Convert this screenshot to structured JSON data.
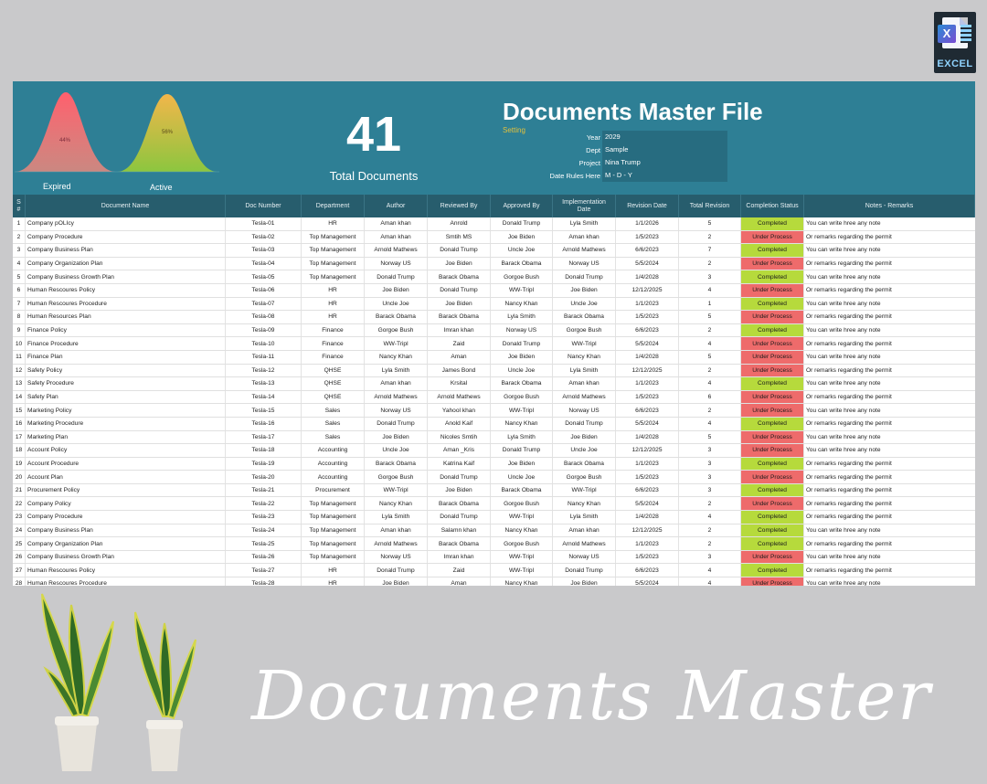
{
  "badge": {
    "label": "EXCEL",
    "letter": "X"
  },
  "header": {
    "title": "Documents Master File",
    "setting": "Setting",
    "total_count": "41",
    "total_label": "Total Documents",
    "gauges": [
      {
        "label": "Expired",
        "percent_text": "44%",
        "percent": 44
      },
      {
        "label": "Active",
        "percent_text": "56%",
        "percent": 56
      }
    ],
    "info": [
      {
        "key": "Year",
        "value": "2029"
      },
      {
        "key": "Dept",
        "value": "Sample"
      },
      {
        "key": "Project",
        "value": "Nina Trump"
      },
      {
        "key": "Date Rules Here",
        "value": "M - D - Y"
      }
    ]
  },
  "table": {
    "columns": [
      "S #",
      "Document Name",
      "Doc Number",
      "Department",
      "Author",
      "Reviewed By",
      "Approved By",
      "Implementation Date",
      "Revision Date",
      "Total Revision",
      "Completion Status",
      "Notes - Remarks"
    ],
    "rows": [
      [
        "1",
        "Company pOLIcy",
        "Tesla-01",
        "HR",
        "Aman khan",
        "Anrold",
        "Donald Trump",
        "Lyla Smith",
        "1/1/2026",
        "5",
        "Completed",
        "You can write hree any note"
      ],
      [
        "2",
        "Company Procedure",
        "Tesla-02",
        "Top Management",
        "Aman khan",
        "Smtih MS",
        "Joe Biden",
        "Aman khan",
        "1/5/2023",
        "2",
        "Under Process",
        "Or remarks regarding the permit"
      ],
      [
        "3",
        "Company Business Plan",
        "Tesla-03",
        "Top Management",
        "Arnold Mathews",
        "Donald Trump",
        "Uncle Joe",
        "Arnold Mathews",
        "6/6/2023",
        "7",
        "Completed",
        "You can write hree any note"
      ],
      [
        "4",
        "Company Organization Plan",
        "Tesla-04",
        "Top Management",
        "Norway US",
        "Joe Biden",
        "Barack Obama",
        "Norway US",
        "5/5/2024",
        "2",
        "Under Process",
        "Or remarks regarding the permit"
      ],
      [
        "5",
        "Company Business Growth Plan",
        "Tesla-05",
        "Top Management",
        "Donald Trump",
        "Barack Obama",
        "Gorgoe Bush",
        "Donald Trump",
        "1/4/2028",
        "3",
        "Completed",
        "You can write hree any note"
      ],
      [
        "6",
        "Human Rescoures Policy",
        "Tesla-06",
        "HR",
        "Joe Biden",
        "Donald Trump",
        "WW-Tripl",
        "Joe Biden",
        "12/12/2025",
        "4",
        "Under Process",
        "Or remarks regarding the permit"
      ],
      [
        "7",
        "Human Rescoures Procedure",
        "Tesla-07",
        "HR",
        "Uncle Joe",
        "Joe Biden",
        "Nancy Khan",
        "Uncle Joe",
        "1/1/2023",
        "1",
        "Completed",
        "You can write hree any note"
      ],
      [
        "8",
        "Human Resources Plan",
        "Tesla-08",
        "HR",
        "Barack Obama",
        "Barack Obama",
        "Lyla Smith",
        "Barack Obama",
        "1/5/2023",
        "5",
        "Under Process",
        "Or remarks regarding the permit"
      ],
      [
        "9",
        "Finance Policy",
        "Tesla-09",
        "Finance",
        "Gorgoe Bush",
        "Imran khan",
        "Norway US",
        "Gorgoe Bush",
        "6/6/2023",
        "2",
        "Completed",
        "You can write hree any note"
      ],
      [
        "10",
        "Finance Procedure",
        "Tesla-10",
        "Finance",
        "WW-Tripl",
        "Zaid",
        "Donald Trump",
        "WW-Tripl",
        "5/5/2024",
        "4",
        "Under Process",
        "Or remarks regarding the permit"
      ],
      [
        "11",
        "Finance Plan",
        "Tesla-11",
        "Finance",
        "Nancy Khan",
        "Aman",
        "Joe Biden",
        "Nancy Khan",
        "1/4/2028",
        "5",
        "Under Process",
        "You can write hree any note"
      ],
      [
        "12",
        "Safety Policy",
        "Tesla-12",
        "QHSE",
        "Lyla Smith",
        "James Bond",
        "Uncle Joe",
        "Lyla Smith",
        "12/12/2025",
        "2",
        "Under Process",
        "Or remarks regarding the permit"
      ],
      [
        "13",
        "Safety Procedure",
        "Tesla-13",
        "QHSE",
        "Aman khan",
        "Krsital",
        "Barack Obama",
        "Aman khan",
        "1/1/2023",
        "4",
        "Completed",
        "You can write hree any note"
      ],
      [
        "14",
        "Safety Plan",
        "Tesla-14",
        "QHSE",
        "Arnold Mathews",
        "Arnold Mathews",
        "Gorgoe Bush",
        "Arnold Mathews",
        "1/5/2023",
        "6",
        "Under Process",
        "Or remarks regarding the permit"
      ],
      [
        "15",
        "Marketing Policy",
        "Tesla-15",
        "Sales",
        "Norway US",
        "Yahool khan",
        "WW-Tripl",
        "Norway US",
        "6/6/2023",
        "2",
        "Under Process",
        "You can write hree any note"
      ],
      [
        "16",
        "Marketing Procedure",
        "Tesla-16",
        "Sales",
        "Donald Trump",
        "Anold Kaif",
        "Nancy Khan",
        "Donald Trump",
        "5/5/2024",
        "4",
        "Completed",
        "Or remarks regarding the permit"
      ],
      [
        "17",
        "Marketing Plan",
        "Tesla-17",
        "Sales",
        "Joe Biden",
        "Nicoles Smtih",
        "Lyla Smith",
        "Joe Biden",
        "1/4/2028",
        "5",
        "Under Process",
        "You can write hree any note"
      ],
      [
        "18",
        "Account Policy",
        "Tesla-18",
        "Accounting",
        "Uncle Joe",
        "Aman _Kris",
        "Donald Trump",
        "Uncle Joe",
        "12/12/2025",
        "3",
        "Under Process",
        "You can write hree any note"
      ],
      [
        "19",
        "Account Procedure",
        "Tesla-19",
        "Accounting",
        "Barack Obama",
        "Katrina Kaif",
        "Joe Biden",
        "Barack Obama",
        "1/1/2023",
        "3",
        "Completed",
        "Or remarks regarding the permit"
      ],
      [
        "20",
        "Account Plan",
        "Tesla-20",
        "Accounting",
        "Gorgoe Bush",
        "Donald Trump",
        "Uncle Joe",
        "Gorgoe Bush",
        "1/5/2023",
        "3",
        "Under Process",
        "Or remarks regarding the permit"
      ],
      [
        "21",
        "Procurement Policy",
        "Tesla-21",
        "Procurement",
        "WW-Tripl",
        "Joe Biden",
        "Barack Obama",
        "WW-Tripl",
        "6/6/2023",
        "3",
        "Completed",
        "Or remarks regarding the permit"
      ],
      [
        "22",
        "Company Policy",
        "Tesla-22",
        "Top Management",
        "Nancy Khan",
        "Barack Obama",
        "Gorgoe Bush",
        "Nancy Khan",
        "5/5/2024",
        "2",
        "Under Process",
        "Or remarks regarding the permit"
      ],
      [
        "23",
        "Company Procedure",
        "Tesla-23",
        "Top Management",
        "Lyla Smith",
        "Donald Trump",
        "WW-Tripl",
        "Lyla Smith",
        "1/4/2028",
        "4",
        "Completed",
        "Or remarks regarding the permit"
      ],
      [
        "24",
        "Company Business Plan",
        "Tesla-24",
        "Top Management",
        "Aman khan",
        "Salamn khan",
        "Nancy Khan",
        "Aman khan",
        "12/12/2025",
        "2",
        "Completed",
        "You can write hree any note"
      ],
      [
        "25",
        "Company Organization Plan",
        "Tesla-25",
        "Top Management",
        "Arnold Mathews",
        "Barack Obama",
        "Gorgoe Bush",
        "Arnold Mathews",
        "1/1/2023",
        "2",
        "Completed",
        "Or remarks regarding the permit"
      ],
      [
        "26",
        "Company Business Growth Plan",
        "Tesla-26",
        "Top Management",
        "Norway US",
        "Imran khan",
        "WW-Tripl",
        "Norway US",
        "1/5/2023",
        "3",
        "Under Process",
        "You can write hree any note"
      ],
      [
        "27",
        "Human Rescoures Policy",
        "Tesla-27",
        "HR",
        "Donald Trump",
        "Zaid",
        "WW-Tripl",
        "Donald Trump",
        "6/6/2023",
        "4",
        "Completed",
        "Or remarks regarding the permit"
      ],
      [
        "28",
        "Human Rescoures Procedure",
        "Tesla-28",
        "HR",
        "Joe Biden",
        "Aman",
        "Nancy Khan",
        "Joe Biden",
        "5/5/2024",
        "4",
        "Under Process",
        "You can write hree any note"
      ]
    ]
  },
  "colors": {
    "header_band": "#2e7f95",
    "grid_header": "#275d6d",
    "completed": "#b6da3c",
    "under_process": "#ee6b6b",
    "title": "#ffffff",
    "setting": "#e2c13c"
  },
  "decor": {
    "script_title": "Documents Master",
    "plants": [
      "snake-plant-left",
      "snake-plant-right"
    ]
  }
}
